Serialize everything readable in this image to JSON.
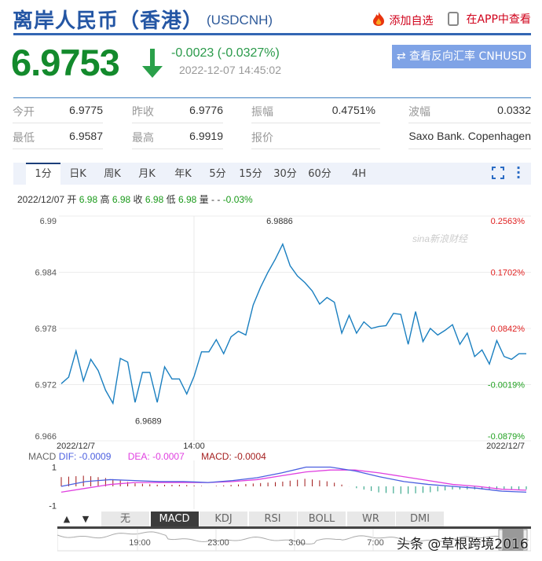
{
  "header": {
    "title": "离岸人民币（香港）",
    "symbol": "(USDCNH)",
    "add_watchlist": "添加自选",
    "view_in_app": "在APP中查看"
  },
  "quote": {
    "price": "6.9753",
    "direction": "down",
    "change": "-0.0023 (-0.0327%)",
    "timestamp": "2022-12-07 14:45:02",
    "reverse_button": "查看反向汇率 CNHUSD"
  },
  "stats": {
    "rows": [
      [
        {
          "label": "今开",
          "value": "6.9775"
        },
        {
          "label": "昨收",
          "value": "6.9776"
        },
        {
          "label": "振幅",
          "value": "0.4751%"
        },
        {
          "label": "波幅",
          "value": "0.0332"
        }
      ],
      [
        {
          "label": "最低",
          "value": "6.9587"
        },
        {
          "label": "最高",
          "value": "6.9919"
        },
        {
          "label": "报价",
          "value": ""
        },
        {
          "label": "",
          "value": "Saxo Bank. Copenhagen"
        }
      ]
    ]
  },
  "tabs": [
    "1分",
    "日K",
    "周K",
    "月K",
    "年K",
    "5分",
    "15分",
    "30分",
    "60分",
    "4H"
  ],
  "active_tab": "1分",
  "info": {
    "date": "2022/12/07",
    "open_label": "开",
    "open": "6.98",
    "high_label": "高",
    "high": "6.98",
    "close_label": "收",
    "close": "6.98",
    "low_label": "低",
    "low": "6.98",
    "volume_label": "量",
    "volume": "-",
    "change": "-0.03%"
  },
  "chart_data": {
    "type": "line",
    "ylim": [
      6.966,
      6.99
    ],
    "y_ticks": [
      "6.99",
      "6.984",
      "6.978",
      "6.972",
      "6.966"
    ],
    "y_tick_values": [
      6.99,
      6.984,
      6.978,
      6.972,
      6.966
    ],
    "pct_ticks": [
      "0.2563%",
      "0.1702%",
      "0.0842%",
      "-0.0019%",
      "-0.0879%"
    ],
    "x_labels": [
      "2022/12/7",
      "14:00",
      "2022/12/7"
    ],
    "max_label": "6.9886",
    "min_label": "6.9689",
    "values": [
      6.9721,
      6.9728,
      6.9756,
      6.9724,
      6.9747,
      6.9735,
      6.9714,
      6.97,
      6.9748,
      6.9744,
      6.9701,
      6.9733,
      6.9733,
      6.9701,
      6.9739,
      6.9726,
      6.9726,
      6.971,
      6.9729,
      6.9755,
      6.9755,
      6.9768,
      6.9753,
      6.9771,
      6.9777,
      6.9773,
      6.9805,
      6.9824,
      6.984,
      6.9854,
      6.987,
      6.9847,
      6.9836,
      6.9829,
      6.982,
      6.9806,
      6.9813,
      6.9808,
      6.9775,
      6.9794,
      6.9775,
      6.9787,
      6.978,
      6.9782,
      6.9783,
      6.9796,
      6.9795,
      6.9763,
      6.9798,
      6.9766,
      6.978,
      6.9773,
      6.9778,
      6.9784,
      6.9763,
      6.9775,
      6.975,
      6.9757,
      6.9742,
      6.9767,
      6.975,
      6.9747,
      6.9753,
      6.9753
    ],
    "line_color": "#1a7fc0",
    "watermark": "sina新浪财经"
  },
  "macd": {
    "label": "MACD",
    "dif_text": "DIF: -0.0009",
    "dea_text": "DEA: -0.0007",
    "macd_text": "MACD: -0.0004",
    "y_ticks": [
      "1",
      "-1"
    ],
    "dif": [
      0.0,
      0.25,
      0.35,
      0.3,
      0.25,
      0.25,
      0.2,
      0.3,
      0.45,
      0.7,
      1.0,
      1.0,
      0.8,
      0.5,
      0.25,
      0.1,
      0.0,
      -0.1,
      -0.25,
      -0.3
    ],
    "dea": [
      -0.3,
      -0.1,
      0.1,
      0.2,
      0.2,
      0.2,
      0.2,
      0.25,
      0.35,
      0.55,
      0.75,
      0.85,
      0.85,
      0.7,
      0.5,
      0.3,
      0.1,
      0.0,
      -0.15,
      -0.2
    ],
    "dif_color": "#4b5fe0",
    "dea_color": "#e040e0"
  },
  "indicator_tabs": [
    "无",
    "MACD",
    "KDJ",
    "RSI",
    "BOLL",
    "WR",
    "DMI"
  ],
  "active_indicator": "MACD",
  "arrows": {
    "up": "▲",
    "down": "▼"
  },
  "range_slider": {
    "labels": [
      "19:00",
      "23:00",
      "3:00",
      "7:00"
    ]
  },
  "watermark": "头条 @草根跨境2016"
}
